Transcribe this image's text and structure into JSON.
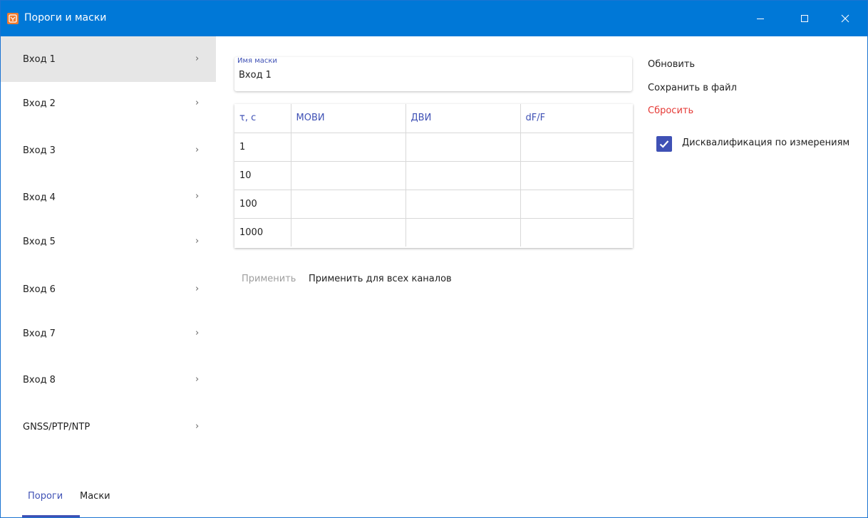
{
  "window": {
    "title": "Пороги и маски",
    "controls": [
      "minimize-icon",
      "maximize-icon",
      "close-icon"
    ]
  },
  "sidebar": {
    "items": [
      {
        "label": "Вход 1",
        "chevron": "›",
        "active": true
      },
      {
        "label": "Вход 2",
        "chevron": "›"
      },
      {
        "label": "Вход 3",
        "chevron": "›"
      },
      {
        "label": "Вход 4",
        "chevron": "›"
      },
      {
        "label": "Вход 5",
        "chevron": "›"
      },
      {
        "label": "Вход 6",
        "chevron": "›"
      },
      {
        "label": "Вход 7",
        "chevron": "›"
      },
      {
        "label": "Вход 8",
        "chevron": "›"
      },
      {
        "label": "GNSS/PTP/NTP",
        "chevron": "›"
      }
    ],
    "tabs": [
      {
        "label": "Пороги",
        "active": true
      },
      {
        "label": "Маски"
      }
    ]
  },
  "mask": {
    "label": "Имя маски",
    "value": "Вход 1"
  },
  "table": {
    "headers": [
      "τ, с",
      "МОВИ",
      "ДВИ",
      "dF/F"
    ],
    "rows": [
      [
        "1",
        "",
        "",
        ""
      ],
      [
        "10",
        "",
        "",
        ""
      ],
      [
        "100",
        "",
        "",
        ""
      ],
      [
        "1000",
        "",
        "",
        ""
      ]
    ]
  },
  "buttons": {
    "apply": "Применить",
    "apply_all": "Применить для всех каналов"
  },
  "actions": {
    "refresh": "Обновить",
    "save": "Сохранить в файл",
    "reset": "Сбросить"
  },
  "checkbox": {
    "label": "Дисквалификация по измерениям",
    "checked": true
  },
  "colors": {
    "titlebar": "#0078d7",
    "accent": "#3f51b5",
    "danger": "#e53935",
    "disabled": "#9e9e9e"
  }
}
